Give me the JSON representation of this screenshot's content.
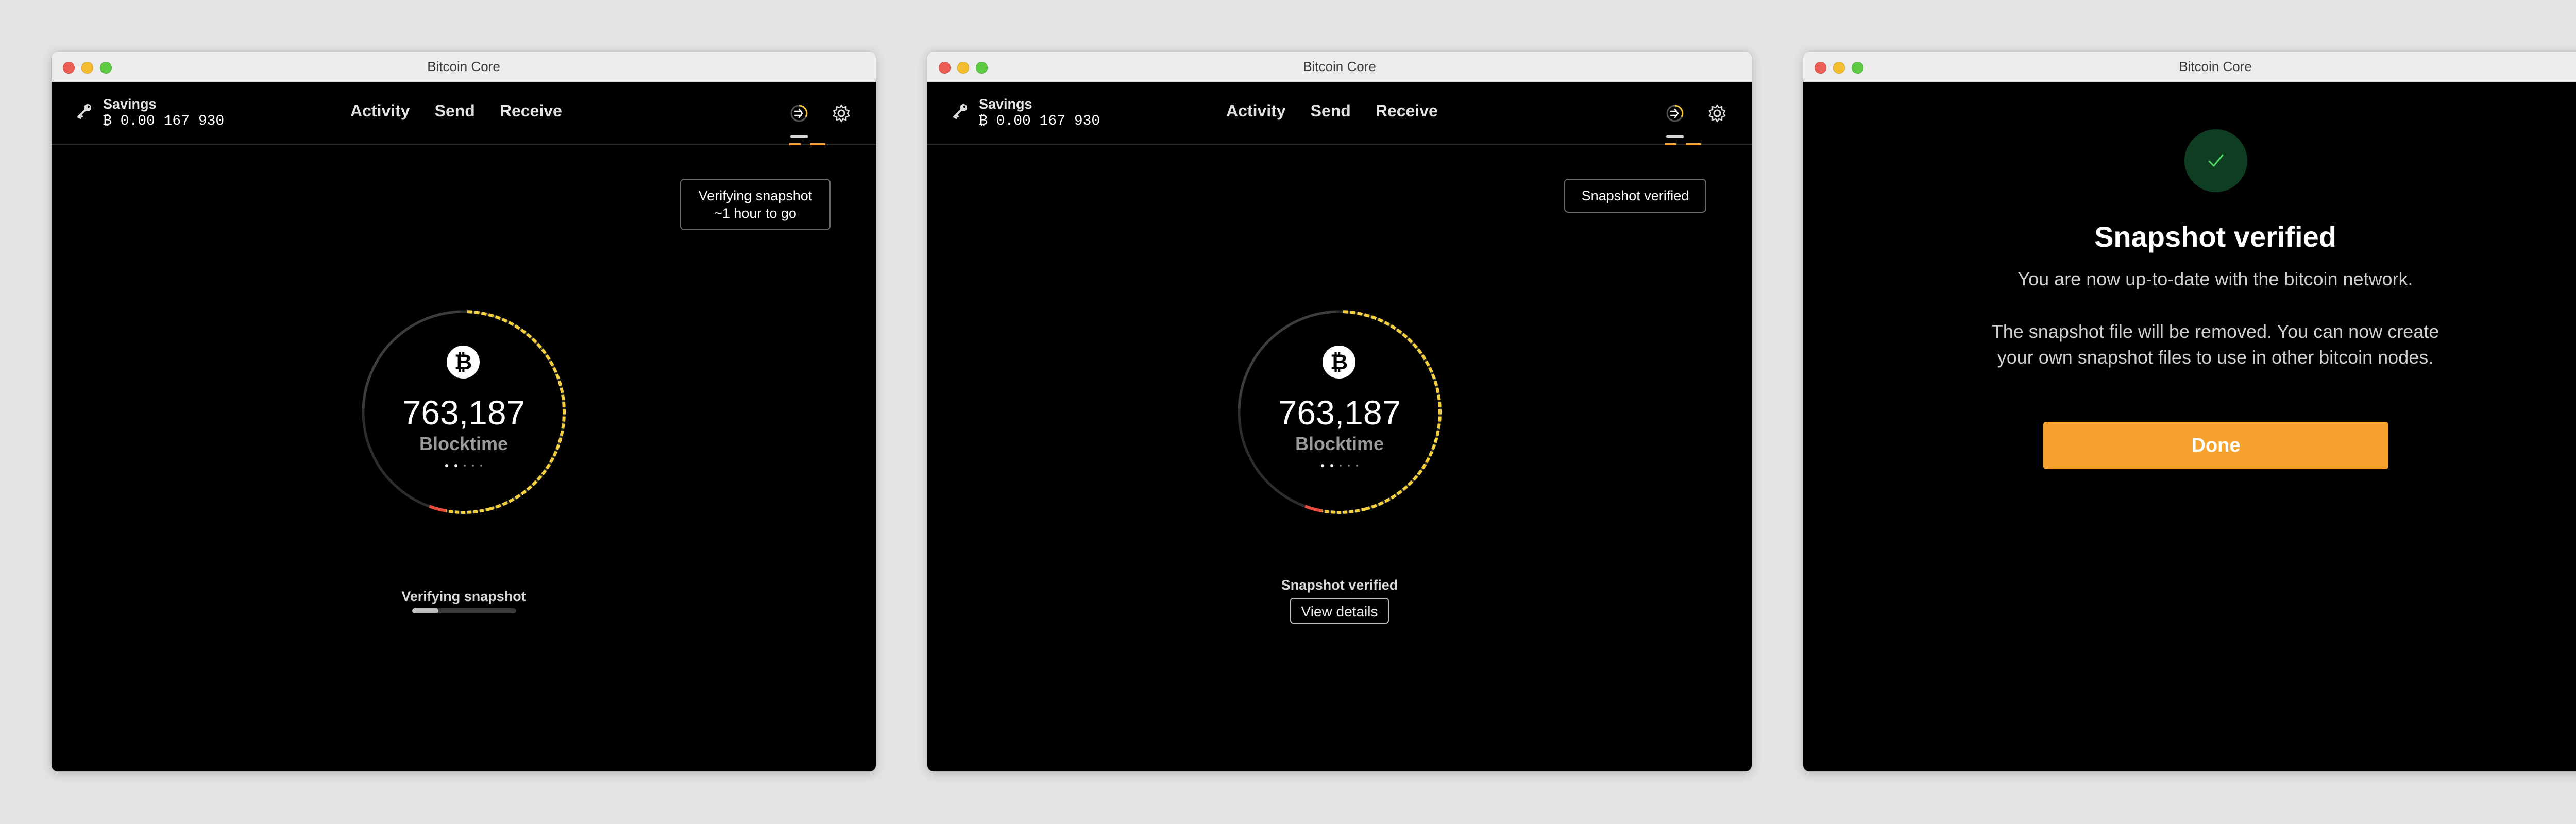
{
  "colors": {
    "background": "#e4e4e4",
    "window_content": "#000000",
    "accent_orange": "#f7a12e",
    "arc_yellow": "#f4d03f",
    "arc_red": "#e74c3c",
    "success_green_bg": "#0e3d22",
    "success_green": "#4cd964"
  },
  "app": {
    "title": "Bitcoin Core"
  },
  "header": {
    "wallet_name": "Savings",
    "wallet_balance": "₿ 0.00 167 930",
    "nav": [
      "Activity",
      "Send",
      "Receive"
    ],
    "icons": [
      "key-icon",
      "block-clock-icon",
      "gear-icon"
    ]
  },
  "screens": [
    {
      "tooltip_line1": "Verifying snapshot",
      "tooltip_line2": "~1 hour to go",
      "block_height": "763,187",
      "block_label": "Blocktime",
      "status": "Verifying snapshot",
      "progress": 0.25
    },
    {
      "tooltip": "Snapshot verified",
      "block_height": "763,187",
      "block_label": "Blocktime",
      "status": "Snapshot verified",
      "button": "View details"
    },
    {
      "title": "Snapshot verified",
      "subtitle": "You are now up-to-date with the bitcoin network.",
      "body": "The snapshot file will be removed. You can now create your own snapshot files to use in other bitcoin nodes.",
      "button": "Done",
      "icon": "checkmark-icon"
    }
  ]
}
